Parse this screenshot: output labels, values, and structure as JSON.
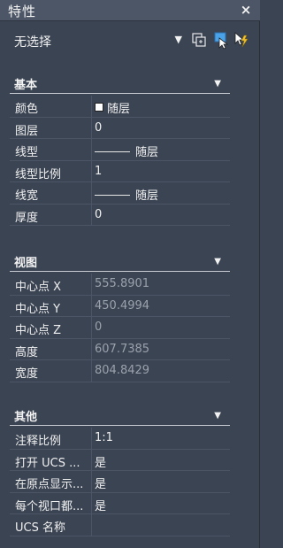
{
  "window": {
    "title": "特性",
    "close": "×"
  },
  "selector": {
    "value": "无选择",
    "arrow": "▼"
  },
  "sections": {
    "basic": {
      "title": "基本",
      "rows": [
        {
          "label": "颜色",
          "value": "随层",
          "swatch_color": "#ffffff"
        },
        {
          "label": "图层",
          "value": "0"
        },
        {
          "label": "线型",
          "value": "随层"
        },
        {
          "label": "线型比例",
          "value": "1"
        },
        {
          "label": "线宽",
          "value": "随层"
        },
        {
          "label": "厚度",
          "value": "0"
        }
      ]
    },
    "view": {
      "title": "视图",
      "rows": [
        {
          "label": "中心点 X",
          "value": "555.8901"
        },
        {
          "label": "中心点 Y",
          "value": "450.4994"
        },
        {
          "label": "中心点 Z",
          "value": "0"
        },
        {
          "label": "高度",
          "value": "607.7385"
        },
        {
          "label": "宽度",
          "value": "804.8429"
        }
      ]
    },
    "other": {
      "title": "其他",
      "rows": [
        {
          "label": "注释比例",
          "value": "1:1"
        },
        {
          "label": "打开 UCS ...",
          "value": "是"
        },
        {
          "label": "在原点显示...",
          "value": "是"
        },
        {
          "label": "每个视口都...",
          "value": "是"
        },
        {
          "label": "UCS 名称",
          "value": ""
        }
      ]
    }
  },
  "colors": {
    "panel_bg": "#3b4453",
    "titlebar_bg": "#4d5666",
    "text": "#f0f0f0",
    "dim_text": "#9aa1ac",
    "accent_blue": "#4aa3e8"
  },
  "icons": {
    "toggle_pickadd": "toggle-pickadd-icon",
    "select_objects": "select-objects-icon",
    "quick_select": "quick-select-icon",
    "collapse": "▼"
  }
}
